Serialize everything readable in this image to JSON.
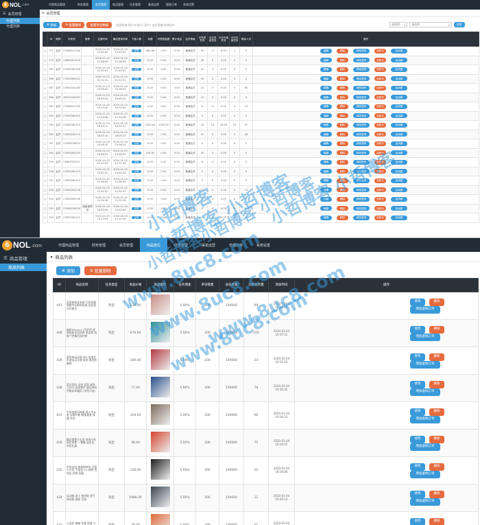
{
  "logo": {
    "mark": "6",
    "text": "NOL",
    "suffix": ".com"
  },
  "watermarks": [
    "小哲博客",
    "小哲博客 小哲博客",
    "小哲博客小哲博客 小哲博客",
    "小哲博客 小哲博客",
    "www.8uc8.com",
    "www.8uc8.com",
    "www.8uc8.com",
    "www.8uc8.com"
  ],
  "shot1": {
    "nav": [
      "代理商品管理",
      "财务管理",
      "会员管理",
      "商品管理",
      "任务管理",
      "渠道运营",
      "管理订单",
      "系统设置"
    ],
    "active_nav": 2,
    "side_header": "会员管理",
    "side_active": "代理列表",
    "side_item": "代理列表",
    "crumb": "会员管理",
    "tool_buttons": [
      "添加",
      "批量删除",
      "批量导出数据"
    ],
    "filter_text": "会员昵称/用户名/账号 (用户)  会员等级/系统用户",
    "selects": [
      "请选择",
      "请选择"
    ],
    "search_label": "搜索",
    "columns": [
      "",
      "ID",
      "昵称",
      "手机号",
      "推荐",
      "注册时间",
      "最后登录时间",
      "下级人数",
      "余额",
      "可提现金额",
      "累计收益",
      "会员等级",
      "已完成任务",
      "今日完成任务",
      "今日可接任务",
      "今日已接任务",
      "剩余人次",
      "操作"
    ],
    "action_labels": [
      "编辑",
      "删除",
      "修改密码",
      "加积分",
      "加余额"
    ],
    "status_label": "正常",
    "rows": [
      [
        "□",
        "771",
        "会员",
        "17856221234",
        "",
        "2020-01-04 12:40:02",
        "2020-01-04 12:40:00",
        "0",
        "485.98",
        "0.00",
        "0.00",
        "普通会员",
        "35",
        "0",
        "6.00",
        "1",
        "5"
      ],
      [
        "□",
        "770",
        "会员",
        "13887012215",
        "",
        "2020-01-04 11:26:59",
        "2020-01-04 11:26:59",
        "0",
        "0.00",
        "0.00",
        "0.00",
        "普通会员",
        "28",
        "0",
        "0.00",
        "0",
        "0"
      ],
      [
        "□",
        "769",
        "会员",
        "17852081258",
        "",
        "2020-01-03 21:40:41",
        "2020-01-03 21:40:41",
        "0",
        "0.00",
        "0.00",
        "0.00",
        "普通会员",
        "20",
        "0",
        "0.00",
        "0",
        "0"
      ],
      [
        "□",
        "768",
        "会员",
        "17852080321",
        "",
        "2020-01-03 21:11:21",
        "2020-01-03 21:11:21",
        "0",
        "0.00",
        "0.00",
        "0.00",
        "普通会员",
        "16",
        "0",
        "0.00",
        "0",
        "0"
      ],
      [
        "□",
        "767",
        "会员",
        "17852041282",
        "",
        "2020-01-03 20:58:42",
        "2020-01-03 20:58:42",
        "0",
        "0.00",
        "0.00",
        "0.00",
        "普通会员",
        "10",
        "0",
        "0.00",
        "0",
        "62"
      ],
      [
        "□",
        "766",
        "会员",
        "18312161007",
        "",
        "2020-01-03 19:45:22",
        "2020-01-03 19:45:22",
        "0",
        "0.00",
        "0.00",
        "0.00",
        "普通会员",
        "12",
        "0",
        "0.00",
        "0",
        "0"
      ],
      [
        "□",
        "765",
        "会员",
        "17856201235",
        "",
        "2020-01-03 19:12:40",
        "2020-01-03 19:12:40",
        "0",
        "0.00",
        "0.00",
        "0.00",
        "普通会员",
        "8",
        "0",
        "0.00",
        "0",
        "15"
      ],
      [
        "□",
        "764",
        "会员",
        "17852081452",
        "",
        "2020-01-03 17:14:08",
        "2020-01-03 17:14:08",
        "0",
        "0.00",
        "0.00",
        "0.00",
        "普通会员",
        "5",
        "0",
        "0.00",
        "0",
        "0"
      ],
      [
        "□",
        "763",
        "会员",
        "17852082214",
        "",
        "2020-01-03 16:20:11",
        "2020-01-03 16:20:11",
        "0",
        "1020.00",
        "1020.00",
        "0.00",
        "普通会员",
        "18",
        "16",
        "28.00",
        "20",
        "37"
      ],
      [
        "□",
        "762",
        "会员",
        "17852042115",
        "",
        "2020-01-03 16:05:12",
        "2020-01-03 16:05:12",
        "0",
        "0.00",
        "0.00",
        "0.00",
        "普通会员",
        "22",
        "0",
        "0.00",
        "0",
        "48"
      ],
      [
        "□",
        "761",
        "会员",
        "13309228974",
        "",
        "2020-01-03 15:58:10",
        "2020-01-03 15:58:10",
        "0",
        "0.00",
        "0.00",
        "0.00",
        "普通会员",
        "0",
        "0",
        "0.00",
        "0",
        "3"
      ],
      [
        "□",
        "760",
        "会员",
        "17852081235",
        "",
        "2020-01-03 15:46:21",
        "2020-01-03 15:46:21",
        "0",
        "418.00",
        "0.00",
        "0.00",
        "普通会员",
        "30",
        "0",
        "0.00",
        "0",
        "0"
      ],
      [
        "□",
        "759",
        "会员",
        "13887015211",
        "",
        "2020-01-03 14:12:34",
        "2020-01-03 14:12:34",
        "0",
        "0.00",
        "0.00",
        "0.00",
        "普通会员",
        "6",
        "0",
        "0.00",
        "0",
        "0"
      ],
      [
        "□",
        "758",
        "会员",
        "17852081274",
        "",
        "2020-01-03 13:41:22",
        "2020-01-03 13:41:22",
        "0",
        "0.00",
        "0.00",
        "0.00",
        "普通会员",
        "0",
        "0",
        "0.00",
        "0",
        "0"
      ],
      [
        "□",
        "757",
        "会员",
        "17852081213",
        "",
        "2020-01-03 12:38:04",
        "2020-01-03 12:38:04",
        "0",
        "0.00",
        "0.00",
        "0.00",
        "普通会员",
        "4",
        "0",
        "0.00",
        "0",
        "0"
      ],
      [
        "□",
        "756",
        "会员",
        "17852081278",
        "",
        "2020-01-03 11:52:37",
        "2020-01-03 11:52:37",
        "0",
        "0.00",
        "0.00",
        "0.00",
        "普通会员",
        "12",
        "0",
        "0.00",
        "0",
        "14"
      ],
      [
        "□",
        "755",
        "会员",
        "17852081236",
        "",
        "2020-01-03 11:24:18",
        "2020-01-03 11:24:18",
        "0",
        "0.00",
        "0.00",
        "0.00",
        "普通会员",
        "2",
        "0",
        "0.00",
        "0",
        "0"
      ],
      [
        "□",
        "754",
        "会员",
        "13309228976",
        "超级管理员",
        "2020-01-03 10:52:09",
        "2020-01-03 10:52:09",
        "0",
        "0.00",
        "0.00",
        "0.00",
        "普通会员",
        "0",
        "0",
        "0.00",
        "0",
        "0"
      ],
      [
        "□",
        "753",
        "会员",
        "17852081211",
        "",
        "2020-01-03 10:12:44",
        "2020-01-03 10:12:44",
        "0",
        "0.00",
        "0.00",
        "0.00",
        "普通会员",
        "0",
        "0",
        "0.00",
        "0",
        "0"
      ]
    ]
  },
  "shot2": {
    "nav": [
      "代理商品管理",
      "财务管理",
      "会员管理",
      "商品管理",
      "任务管理",
      "渠道运营",
      "管理订单",
      "系统设置"
    ],
    "active_nav": 3,
    "side_header": "商品管理",
    "side_active": "商品列表",
    "crumb": "商品列表",
    "tool_buttons": [
      "添加",
      "批量删除"
    ],
    "columns": [
      "ID",
      "商品名称",
      "任务类型",
      "商品价格",
      "商品图片",
      "任务佣金",
      "单日限量",
      "总任务量",
      "已抢任务量",
      "添加时间",
      "操作"
    ],
    "action_labels": [
      "修改",
      "删除",
      "增加虚拟订单"
    ],
    "rows": [
      {
        "id": "441",
        "name": "夏季新款连衣裙 气质显瘦 收腰中长款碎花裙 仙女裙 法式复古",
        "type": "淘宝",
        "price": "238.00",
        "img_color": "#c98d86",
        "commission": "5.00%",
        "daily": "200",
        "total": "100000",
        "grabbed": "99",
        "time": "2020-01-04 10:34:18"
      },
      {
        "id": "440",
        "name": "新款iPhone11手机壳 透明硅胶全包防摔 男女款 创意个性情侣保护套",
        "type": "淘宝",
        "price": "679.00",
        "img_color": "#2e8f99",
        "commission": "5.00%",
        "daily": "200",
        "total": "100000",
        "grabbed": "103",
        "time": "2020-01-03 10:37:21"
      },
      {
        "id": "439",
        "name": "家用电动牙刷 成人充电式声波自动牙刷 软毛 情侣款 套装",
        "type": "淘宝",
        "price": "189.00",
        "img_color": "#b23a42",
        "commission": "5.00%",
        "daily": "200",
        "total": "100000",
        "grabbed": "24",
        "time": "2020-01-04 19:21:02"
      },
      {
        "id": "438",
        "name": "蓝牙耳机 无线 双耳 迷你入耳式 运动跑步 超长待机 苹果安卓通用 (多色可选)",
        "type": "淘宝",
        "price": "77.00",
        "img_color": "#2a4f8a",
        "commission": "5.00%",
        "daily": "200",
        "total": "100000",
        "grabbed": "79",
        "time": "2020-01-04 19:20:42"
      },
      {
        "id": "437",
        "name": "冬季加厚羽绒服 男士中长款 连帽外套 韩版潮流 保暖 外衣",
        "type": "淘宝",
        "price": "318.00",
        "img_color": "#7d6a5c",
        "commission": "5.00%",
        "daily": "200",
        "total": "100000",
        "grabbed": "96",
        "time": "2020-01-04 19:20:31"
      },
      {
        "id": "436",
        "name": "精品零食大礼包 休闲小吃 网红零食 一整箱 送女友 年货礼盒",
        "type": "淘宝",
        "price": "38.00",
        "img_color": "#d2452f",
        "commission": "5.00%",
        "daily": "200",
        "total": "100000",
        "grabbed": "75",
        "time": "2020-01-04 19:20:07"
      },
      {
        "id": "435",
        "name": "时尚女包 单肩斜挎包 百搭小方包 手提包 ins 新款 包包女 质感 高级",
        "type": "淘宝",
        "price": "158.00",
        "img_color": "#1f1f1f",
        "commission": "5.00%",
        "daily": "200",
        "total": "100000",
        "grabbed": "22",
        "time": "2020-01-04 19:20:06"
      },
      {
        "id": "434",
        "name": "运动鞋 男士 跑步鞋 透气 休闲鞋 潮流 百搭",
        "type": "淘宝",
        "price": "5988.00",
        "img_color": "#3b4552",
        "commission": "5.00%",
        "daily": "200",
        "total": "100000",
        "grabbed": "11",
        "time": "2020-01-04 19:20:13"
      },
      {
        "id": "433",
        "name": "小龙虾 麻辣 熟食 即食 大号 真空 包装 零食 特产",
        "type": "淘宝",
        "price": "38.00",
        "img_color": "#df6a3a",
        "commission": "5.00%",
        "daily": "200",
        "total": "100000",
        "grabbed": "65",
        "time": "2020-01-04 19:20:15"
      }
    ]
  }
}
